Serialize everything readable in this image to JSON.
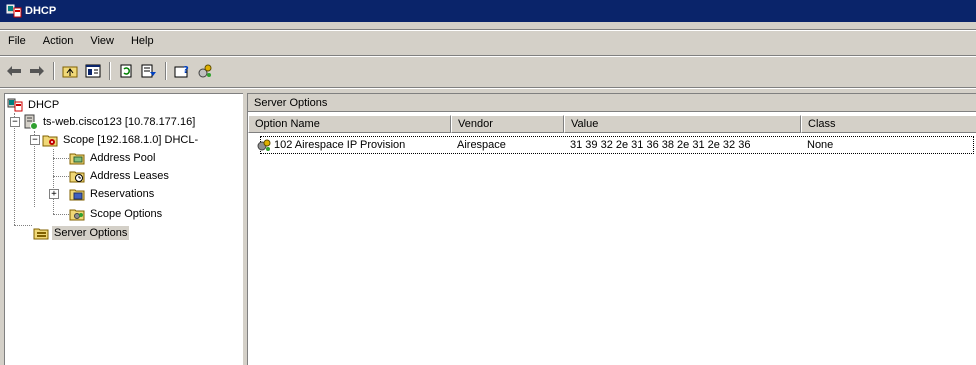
{
  "window": {
    "title": "DHCP"
  },
  "menu": [
    "File",
    "Action",
    "View",
    "Help"
  ],
  "toolbar": {
    "buttons": [
      "back-arrow-icon",
      "forward-arrow-icon",
      "up-folder-icon",
      "show-hide-tree-icon",
      "refresh-icon",
      "export-list-icon",
      "help-icon",
      "dhcp-server-icon"
    ]
  },
  "tree": {
    "root": "DHCP",
    "server": "ts-web.cisco123 [10.78.177.16]",
    "scope": "Scope [192.168.1.0] DHCL-",
    "scope_children": [
      "Address Pool",
      "Address Leases",
      "Reservations",
      "Scope Options"
    ],
    "server_options": "Server Options",
    "expander_minus": "−",
    "expander_plus": "+"
  },
  "details": {
    "title": "Server Options",
    "columns": [
      "Option Name",
      "Vendor",
      "Value",
      "Class"
    ],
    "rows": [
      {
        "option_name": "102 Airespace IP Provision",
        "vendor": "Airespace",
        "value": "31 39 32 2e 31 36 38 2e 31 2e 32 36",
        "class": "None"
      }
    ]
  }
}
